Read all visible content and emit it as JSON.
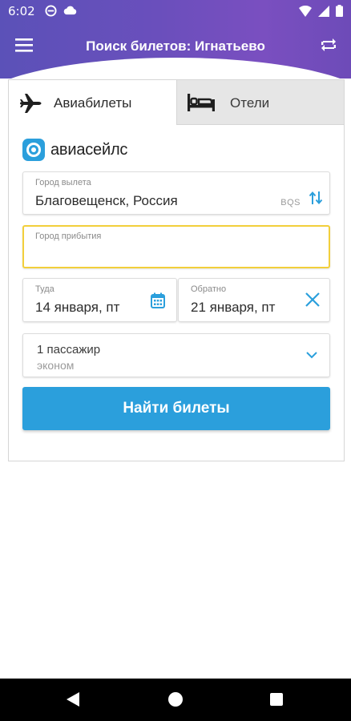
{
  "status_bar": {
    "time": "6:02",
    "icons": [
      "do-not-disturb-icon",
      "cloud-icon",
      "wifi-icon",
      "signal-icon",
      "battery-icon"
    ]
  },
  "app_bar": {
    "title": "Поиск билетов: Игнатьево",
    "gradient_colors": [
      "#5b51b8",
      "#7a4fc0"
    ]
  },
  "tabs": [
    {
      "label": "Авиабилеты",
      "icon": "airplane-icon",
      "active": true
    },
    {
      "label": "Отели",
      "icon": "bed-icon",
      "active": false
    }
  ],
  "brand": {
    "name": "авиасейлс",
    "icon": "aviasales-logo-icon",
    "color": "#2b9fdc"
  },
  "form": {
    "from": {
      "caption": "Город вылета",
      "value": "Благовещенск, Россия",
      "code": "BQS"
    },
    "to": {
      "caption": "Город прибытия",
      "value": ""
    },
    "depart": {
      "caption": "Туда",
      "value": "14 января, пт"
    },
    "return": {
      "caption": "Обратно",
      "value": "21 января, пт"
    },
    "passengers": {
      "count": "1 пассажир",
      "class": "эконом"
    },
    "search_button": "Найти билеты"
  },
  "colors": {
    "accent": "#2b9fdc",
    "focus_border": "#f2cf3b"
  }
}
